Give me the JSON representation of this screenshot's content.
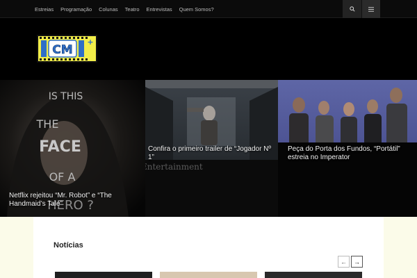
{
  "nav": {
    "items": [
      "Estreias",
      "Programação",
      "Colunas",
      "Teatro",
      "Entrevistas",
      "Quem Somos?"
    ],
    "search_icon": "search-icon",
    "menu_icon": "hamburger-menu-icon"
  },
  "logo": {
    "text": "CM",
    "sup": "+",
    "colors": {
      "frame": "#f2ee49",
      "text": "#2f6fc7",
      "plus": "#2f6fc7",
      "border": "#111111"
    }
  },
  "hero": {
    "tile1": {
      "caption": "Netflix rejeitou “Mr. Robot” e “The Handmaid’s Tale”",
      "poster_lines": [
        "IS THIS",
        "THE",
        "FACE",
        "OF A",
        "HERO ?"
      ]
    },
    "tile2": {
      "caption": "Confira o primeiro trailer de “Jogador Nº 1”",
      "watermark": "Entertainment"
    },
    "tile3": {
      "caption": "Peça do Porta dos Fundos, “Portátil” estreia no Imperator"
    }
  },
  "section": {
    "title": "Notícias",
    "prev_icon": "arrow-left-icon",
    "next_icon": "arrow-right-icon"
  }
}
